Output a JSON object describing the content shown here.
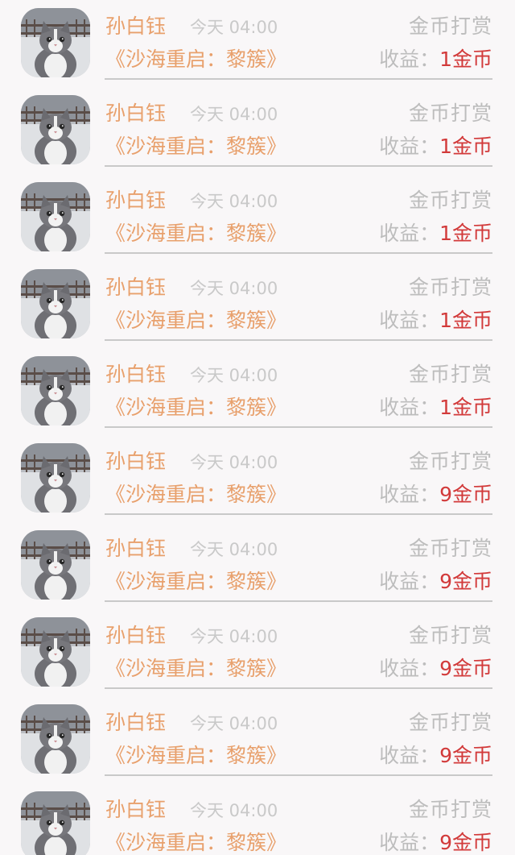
{
  "records": [
    {
      "name": "孙白钰",
      "time": "今天 04:00",
      "type": "金币打赏",
      "book": "《沙海重启：黎簇》",
      "earn_label": "收益：",
      "earn_value": "1金币"
    },
    {
      "name": "孙白钰",
      "time": "今天 04:00",
      "type": "金币打赏",
      "book": "《沙海重启：黎簇》",
      "earn_label": "收益：",
      "earn_value": "1金币"
    },
    {
      "name": "孙白钰",
      "time": "今天 04:00",
      "type": "金币打赏",
      "book": "《沙海重启：黎簇》",
      "earn_label": "收益：",
      "earn_value": "1金币"
    },
    {
      "name": "孙白钰",
      "time": "今天 04:00",
      "type": "金币打赏",
      "book": "《沙海重启：黎簇》",
      "earn_label": "收益：",
      "earn_value": "1金币"
    },
    {
      "name": "孙白钰",
      "time": "今天 04:00",
      "type": "金币打赏",
      "book": "《沙海重启：黎簇》",
      "earn_label": "收益：",
      "earn_value": "1金币"
    },
    {
      "name": "孙白钰",
      "time": "今天 04:00",
      "type": "金币打赏",
      "book": "《沙海重启：黎簇》",
      "earn_label": "收益：",
      "earn_value": "9金币"
    },
    {
      "name": "孙白钰",
      "time": "今天 04:00",
      "type": "金币打赏",
      "book": "《沙海重启：黎簇》",
      "earn_label": "收益：",
      "earn_value": "9金币"
    },
    {
      "name": "孙白钰",
      "time": "今天 04:00",
      "type": "金币打赏",
      "book": "《沙海重启：黎簇》",
      "earn_label": "收益：",
      "earn_value": "9金币"
    },
    {
      "name": "孙白钰",
      "time": "今天 04:00",
      "type": "金币打赏",
      "book": "《沙海重启：黎簇》",
      "earn_label": "收益：",
      "earn_value": "9金币"
    },
    {
      "name": "孙白钰",
      "time": "今天 04:00",
      "type": "金币打赏",
      "book": "《沙海重启：黎簇》",
      "earn_label": "收益：",
      "earn_value": "9金币"
    }
  ],
  "avatar_icon": "cat-avatar-icon",
  "colors": {
    "name": "#e8a06c",
    "time": "#c9c9c9",
    "label": "#bdbdbd",
    "earn_value": "#d23a3a",
    "divider": "#c9c9c9",
    "background": "#f9f7f8"
  }
}
